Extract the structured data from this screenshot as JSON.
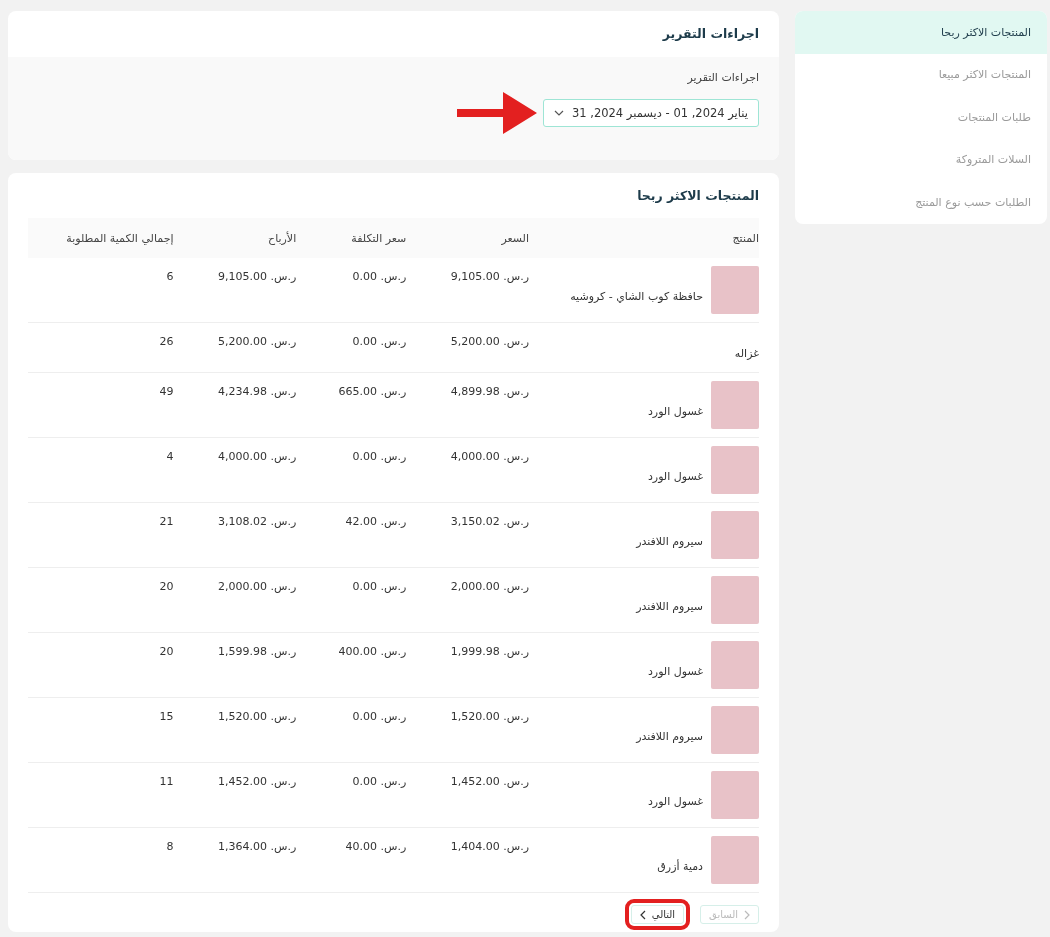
{
  "sidebar": {
    "items": [
      {
        "label": "المنتجات الاكثر ربحا",
        "selected": true
      },
      {
        "label": "المنتجات الاكثر مبيعا",
        "selected": false
      },
      {
        "label": "طلبات المنتجات",
        "selected": false
      },
      {
        "label": "السلات المتروكة",
        "selected": false
      },
      {
        "label": "الطلبات حسب نوع المنتج",
        "selected": false
      }
    ]
  },
  "report_actions": {
    "title": "اجراءات التقرير",
    "field_label": "اجراءات التقرير",
    "date_range": "يناير 2024, 01 - ديسمبر 2024, 31"
  },
  "table_card": {
    "title": "المنتجات الاكثر ربحا",
    "columns": [
      "المنتج",
      "السعر",
      "سعر التكلفة",
      "الأرباح",
      "إجمالي الكمية المطلوبة"
    ],
    "rows": [
      {
        "product": "حافظة كوب الشاي - كروشيه",
        "has_image": true,
        "price": "ر.س. 9,105.00",
        "cost": "ر.س. 0.00",
        "profit": "ر.س. 9,105.00",
        "quantity": "6"
      },
      {
        "product": "غزاله",
        "has_image": false,
        "price": "ر.س. 5,200.00",
        "cost": "ر.س. 0.00",
        "profit": "ر.س. 5,200.00",
        "quantity": "26"
      },
      {
        "product": "غسول الورد",
        "has_image": true,
        "price": "ر.س. 4,899.98",
        "cost": "ر.س. 665.00",
        "profit": "ر.س. 4,234.98",
        "quantity": "49"
      },
      {
        "product": "غسول الورد",
        "has_image": true,
        "price": "ر.س. 4,000.00",
        "cost": "ر.س. 0.00",
        "profit": "ر.س. 4,000.00",
        "quantity": "4"
      },
      {
        "product": "سيروم اللافندر",
        "has_image": true,
        "price": "ر.س. 3,150.02",
        "cost": "ر.س. 42.00",
        "profit": "ر.س. 3,108.02",
        "quantity": "21"
      },
      {
        "product": "سيروم اللافندر",
        "has_image": true,
        "price": "ر.س. 2,000.00",
        "cost": "ر.س. 0.00",
        "profit": "ر.س. 2,000.00",
        "quantity": "20"
      },
      {
        "product": "غسول الورد",
        "has_image": true,
        "price": "ر.س. 1,999.98",
        "cost": "ر.س. 400.00",
        "profit": "ر.س. 1,599.98",
        "quantity": "20"
      },
      {
        "product": "سيروم اللافندر",
        "has_image": true,
        "price": "ر.س. 1,520.00",
        "cost": "ر.س. 0.00",
        "profit": "ر.س. 1,520.00",
        "quantity": "15"
      },
      {
        "product": "غسول الورد",
        "has_image": true,
        "price": "ر.س. 1,452.00",
        "cost": "ر.س. 0.00",
        "profit": "ر.س. 1,452.00",
        "quantity": "11"
      },
      {
        "product": "دمية أزرق",
        "has_image": true,
        "price": "ر.س. 1,404.00",
        "cost": "ر.س. 40.00",
        "profit": "ر.س. 1,364.00",
        "quantity": "8"
      }
    ],
    "pagination": {
      "previous": {
        "label": "السابق",
        "disabled": true
      },
      "next": {
        "label": "التالي",
        "disabled": false
      }
    }
  }
}
